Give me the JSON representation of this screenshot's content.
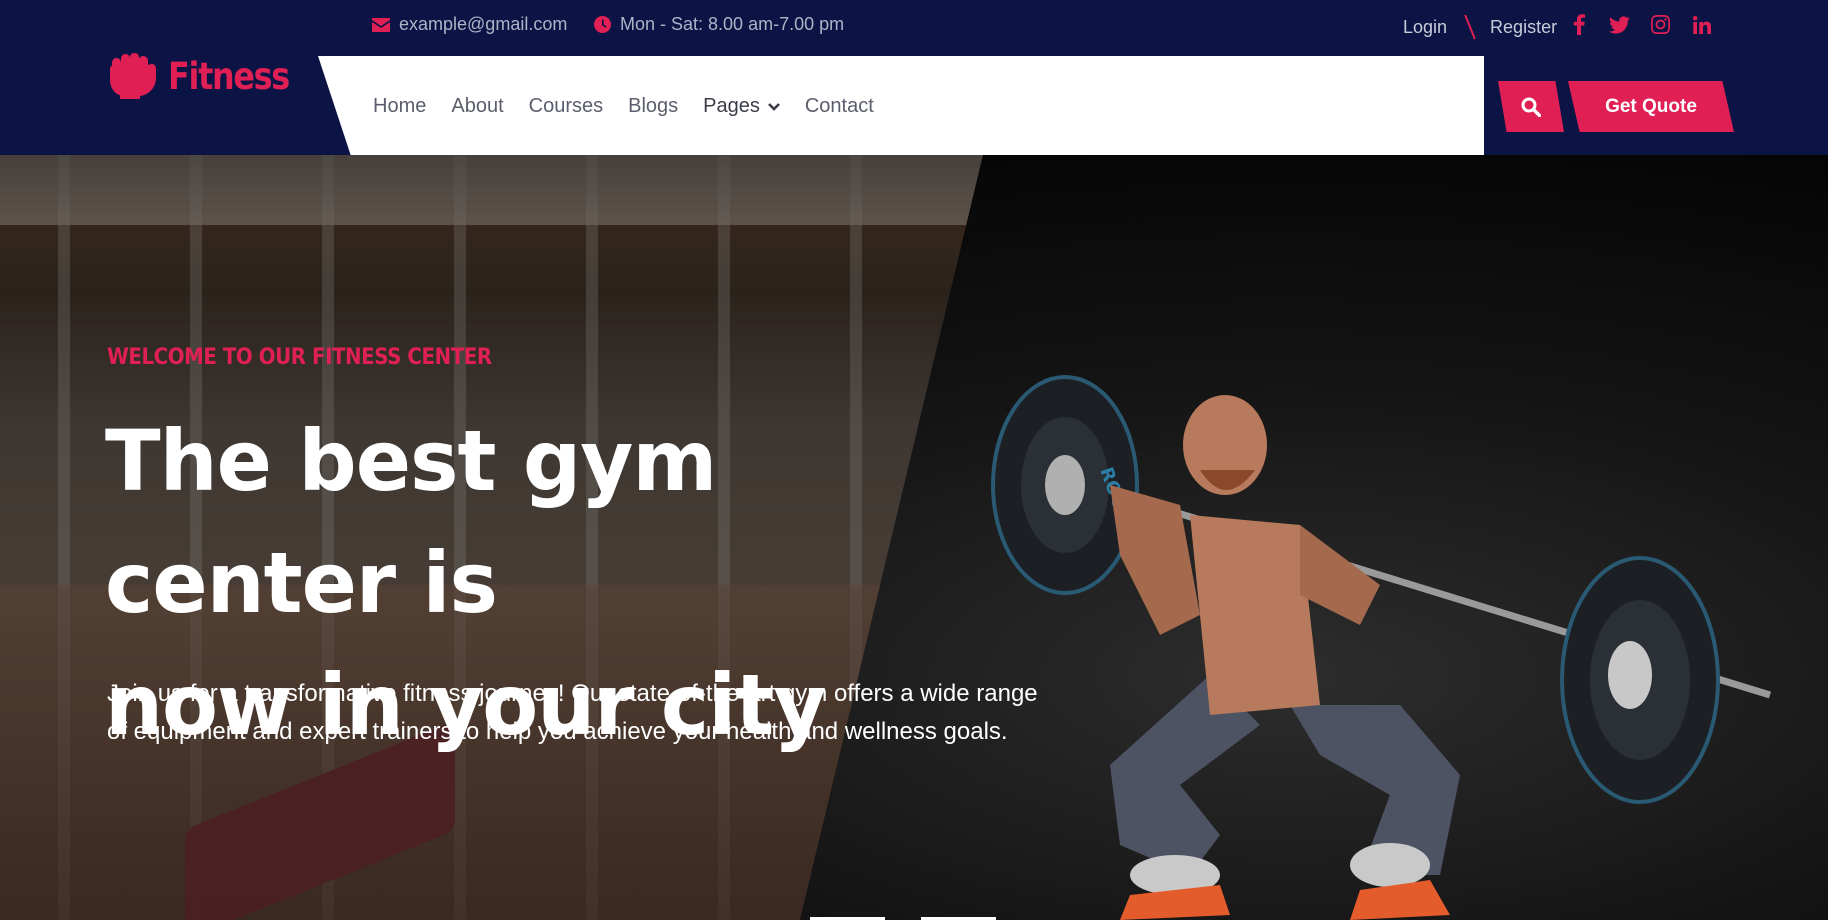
{
  "topbar": {
    "email": "example@gmail.com",
    "hours": "Mon - Sat: 8.00 am-7.00 pm",
    "login_label": "Login",
    "register_label": "Register",
    "social_icons": [
      "facebook-icon",
      "twitter-icon",
      "instagram-icon",
      "linkedin-icon"
    ]
  },
  "brand": {
    "name": "Fitness",
    "accent_color": "#e01f55",
    "navy_color": "#0b1444"
  },
  "nav": {
    "items": [
      {
        "label": "Home"
      },
      {
        "label": "About"
      },
      {
        "label": "Courses"
      },
      {
        "label": "Blogs"
      },
      {
        "label": "Pages"
      },
      {
        "label": "Contact"
      }
    ]
  },
  "actions": {
    "get_quote_label": "Get Quote"
  },
  "hero": {
    "tagline": "WELCOME TO OUR FITNESS CENTER",
    "title_line1": "The best gym center is",
    "title_line2": "now in your city",
    "description": "Join us for a transformative fitness journey! Our state-of-the-art gym offers a wide range of equipment and expert trainers to help you achieve your health and wellness goals.",
    "plate_text": "ROGUE"
  }
}
